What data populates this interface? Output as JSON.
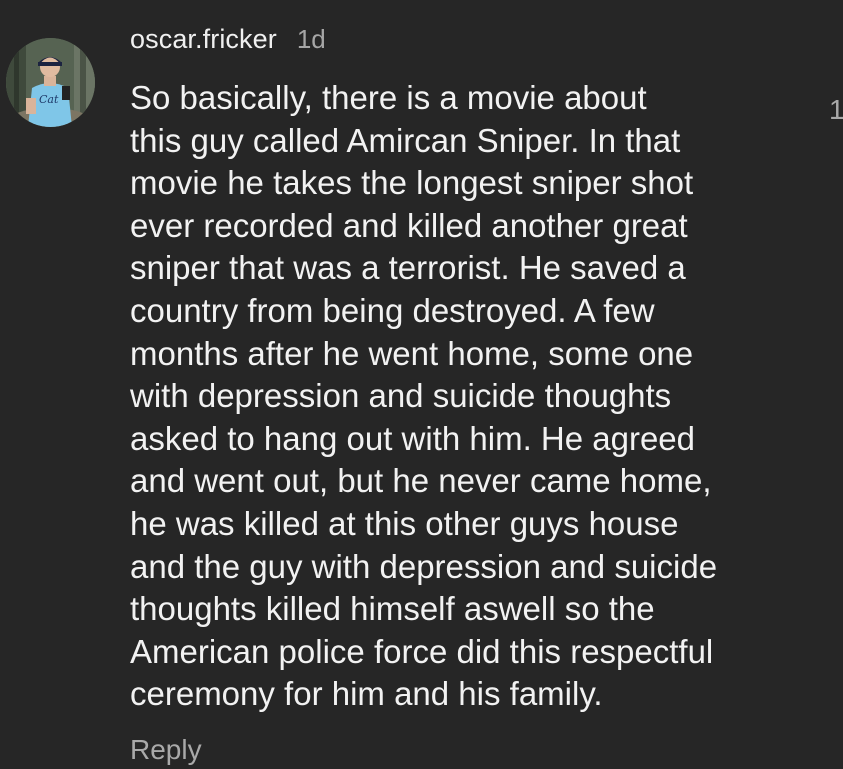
{
  "comment": {
    "avatar_icon": "profile-photo",
    "username": "oscar.fricker",
    "timestamp": "1d",
    "text": "So basically, there is a movie about\nthis guy called Amircan Sniper. In that\nmovie he takes the longest sniper shot\never recorded and killed another great\nsniper that was a terrorist. He saved a\ncountry from being destroyed. A few\nmonths after he went home, some one\nwith depression and suicide thoughts\nasked to hang out with him. He agreed\nand went out, but he never came home,\nhe was killed at this other guys house\nand the guy with depression and suicide\nthoughts killed himself aswell so the\nAmerican police force did this respectful\nceremony for him and his family.",
    "reply_label": "Reply",
    "like_count": "1"
  },
  "colors": {
    "background": "#262626",
    "primary_text": "#f2f2f2",
    "secondary_text": "#a6a6a6"
  }
}
